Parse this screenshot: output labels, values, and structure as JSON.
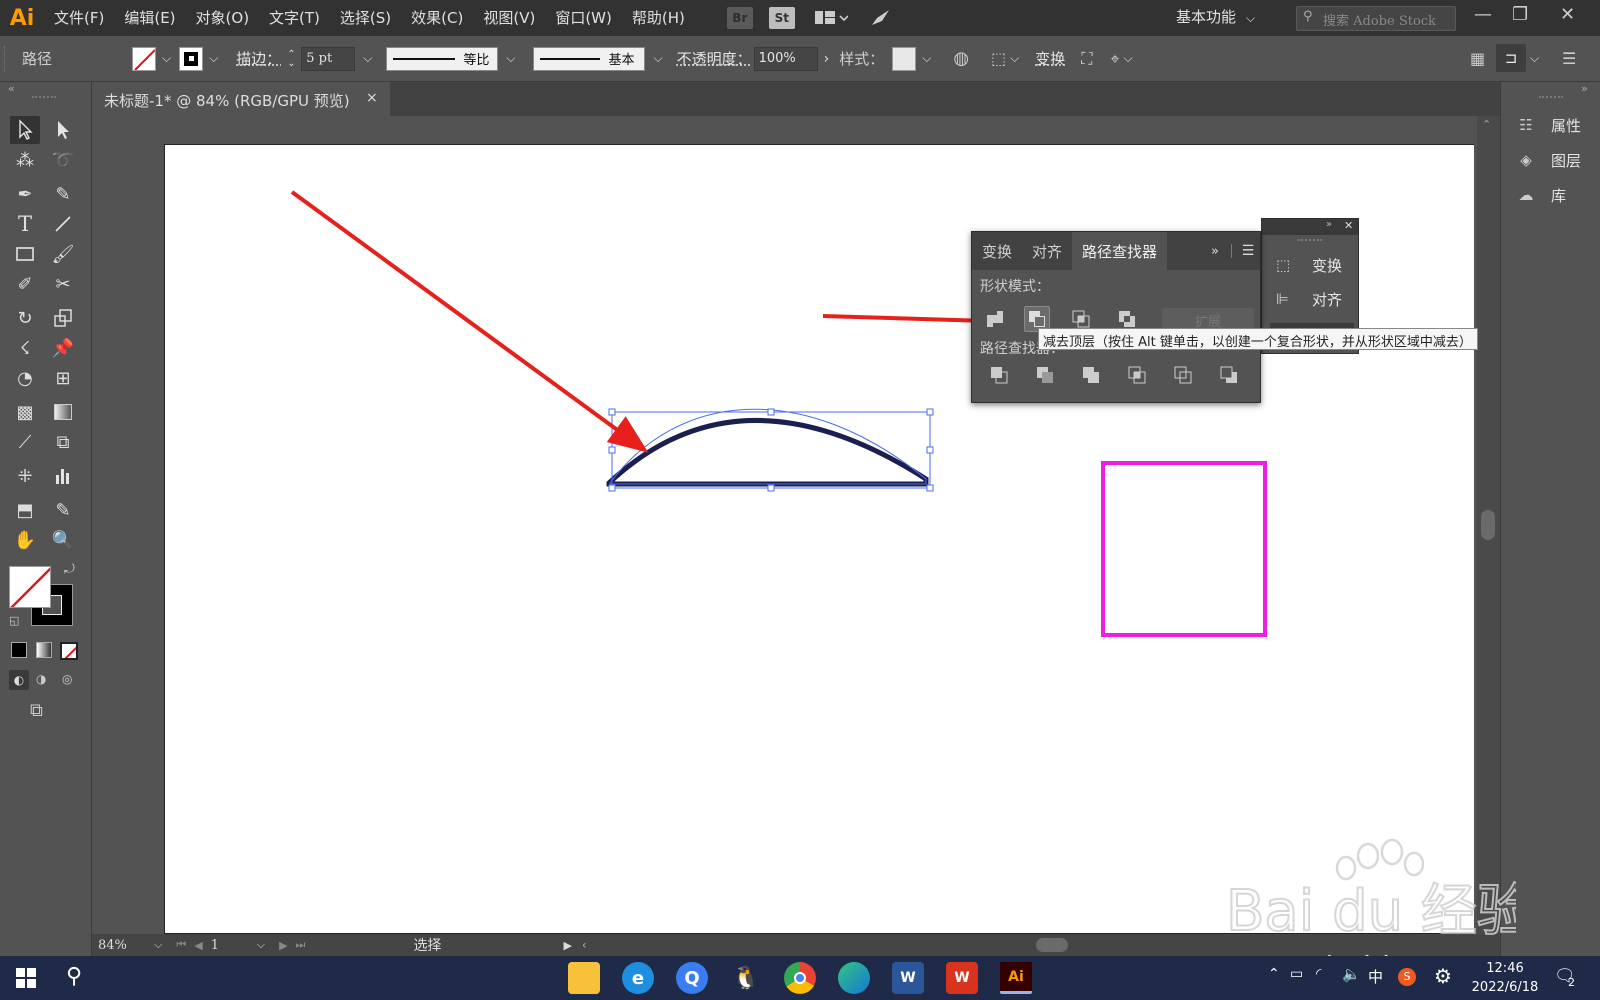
{
  "app": {
    "logo": "Ai"
  },
  "menu": [
    "文件(F)",
    "编辑(E)",
    "对象(O)",
    "文字(T)",
    "选择(S)",
    "效果(C)",
    "视图(V)",
    "窗口(W)",
    "帮助(H)"
  ],
  "menu_icons": {
    "bridge": "Br",
    "stock": "St"
  },
  "workspace": "基本功能",
  "stock_search_placeholder": "搜索 Adobe Stock",
  "control": {
    "selection_type": "路径",
    "stroke_label": "描边：",
    "stroke_value": "5 pt",
    "profile": "等比",
    "brush": "基本",
    "opacity_label": "不透明度：",
    "opacity_value": "100%",
    "style_label": "样式：",
    "transform_label": "变换"
  },
  "document_tab": {
    "title": "未标题-1* @ 84% (RGB/GPU 预览)",
    "close": "×"
  },
  "colors": {
    "accent_orange": "#ff9a00",
    "selection_blue": "#4a6cf0",
    "path_navy": "#1b1f50",
    "arrow_red": "#e8201c",
    "square_magenta": "#f21ce8"
  },
  "right_dock": [
    "属性",
    "图层",
    "库"
  ],
  "pathfinder_panel": {
    "tabs": [
      "变换",
      "对齐",
      "路径查找器"
    ],
    "active_tab": "路径查找器",
    "shape_modes_label": "形状模式：",
    "pathfinders_label": "路径查找器：",
    "expand_label": "扩展",
    "tooltip": "减去顶层（按住 Alt 键单击，以创建一个复合形状，并从形状区域中减去）"
  },
  "mini_panel": [
    "变换",
    "对齐"
  ],
  "status": {
    "zoom": "84%",
    "artboard": "1",
    "mode": "选择"
  },
  "taskbar": {
    "ime": "中",
    "time": "12:46",
    "date": "2022/6/18",
    "notif_count": "2"
  },
  "watermark": {
    "line1": "Bai du 经验",
    "line2": "jingyan.baidu.com"
  }
}
